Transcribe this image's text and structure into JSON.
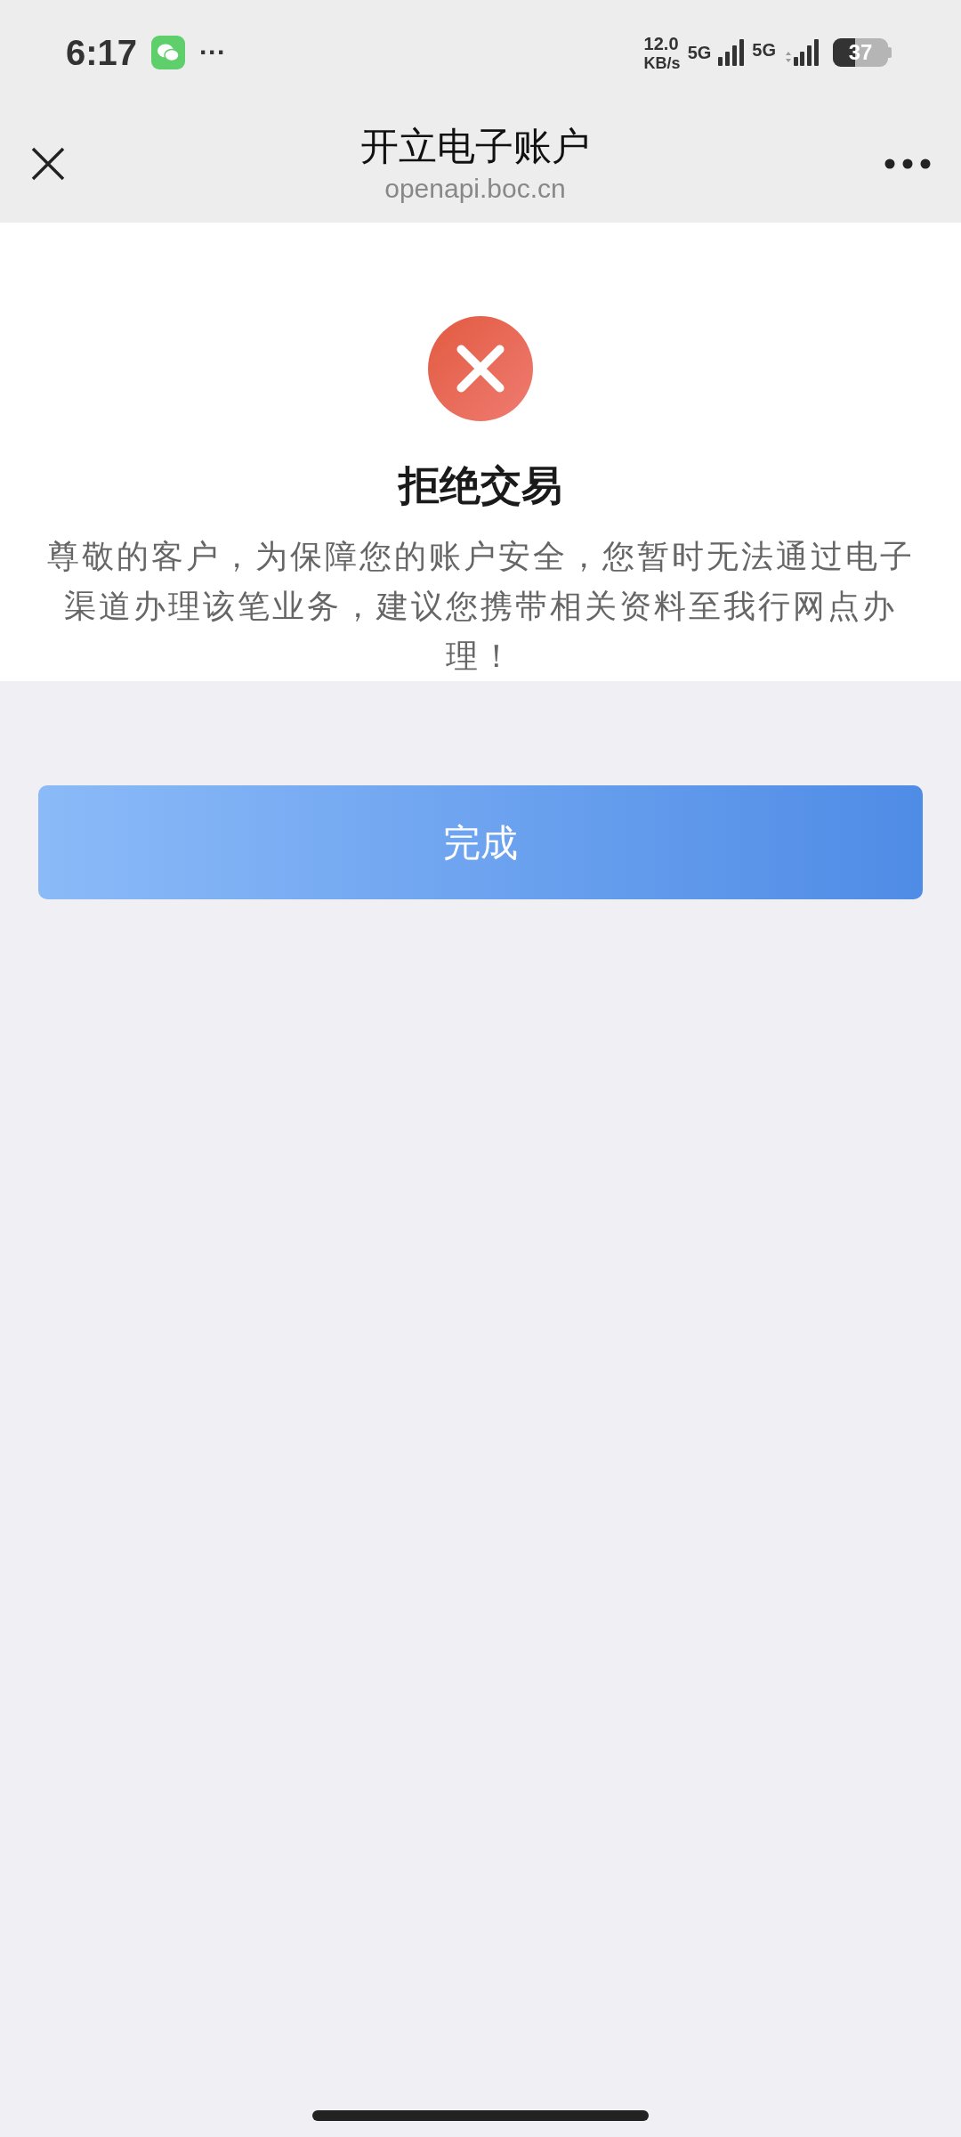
{
  "status_bar": {
    "time": "6:17",
    "more": "···",
    "speed": "12.0",
    "speed_unit": "KB/s",
    "network_1": "5G",
    "network_2": "5G",
    "battery": "37"
  },
  "header": {
    "title": "开立电子账户",
    "subtitle": "openapi.boc.cn"
  },
  "result": {
    "title": "拒绝交易",
    "message": "尊敬的客户，为保障您的账户安全，您暂时无法通过电子渠道办理该笔业务，建议您携带相关资料至我行网点办理！"
  },
  "buttons": [
    "完成"
  ]
}
